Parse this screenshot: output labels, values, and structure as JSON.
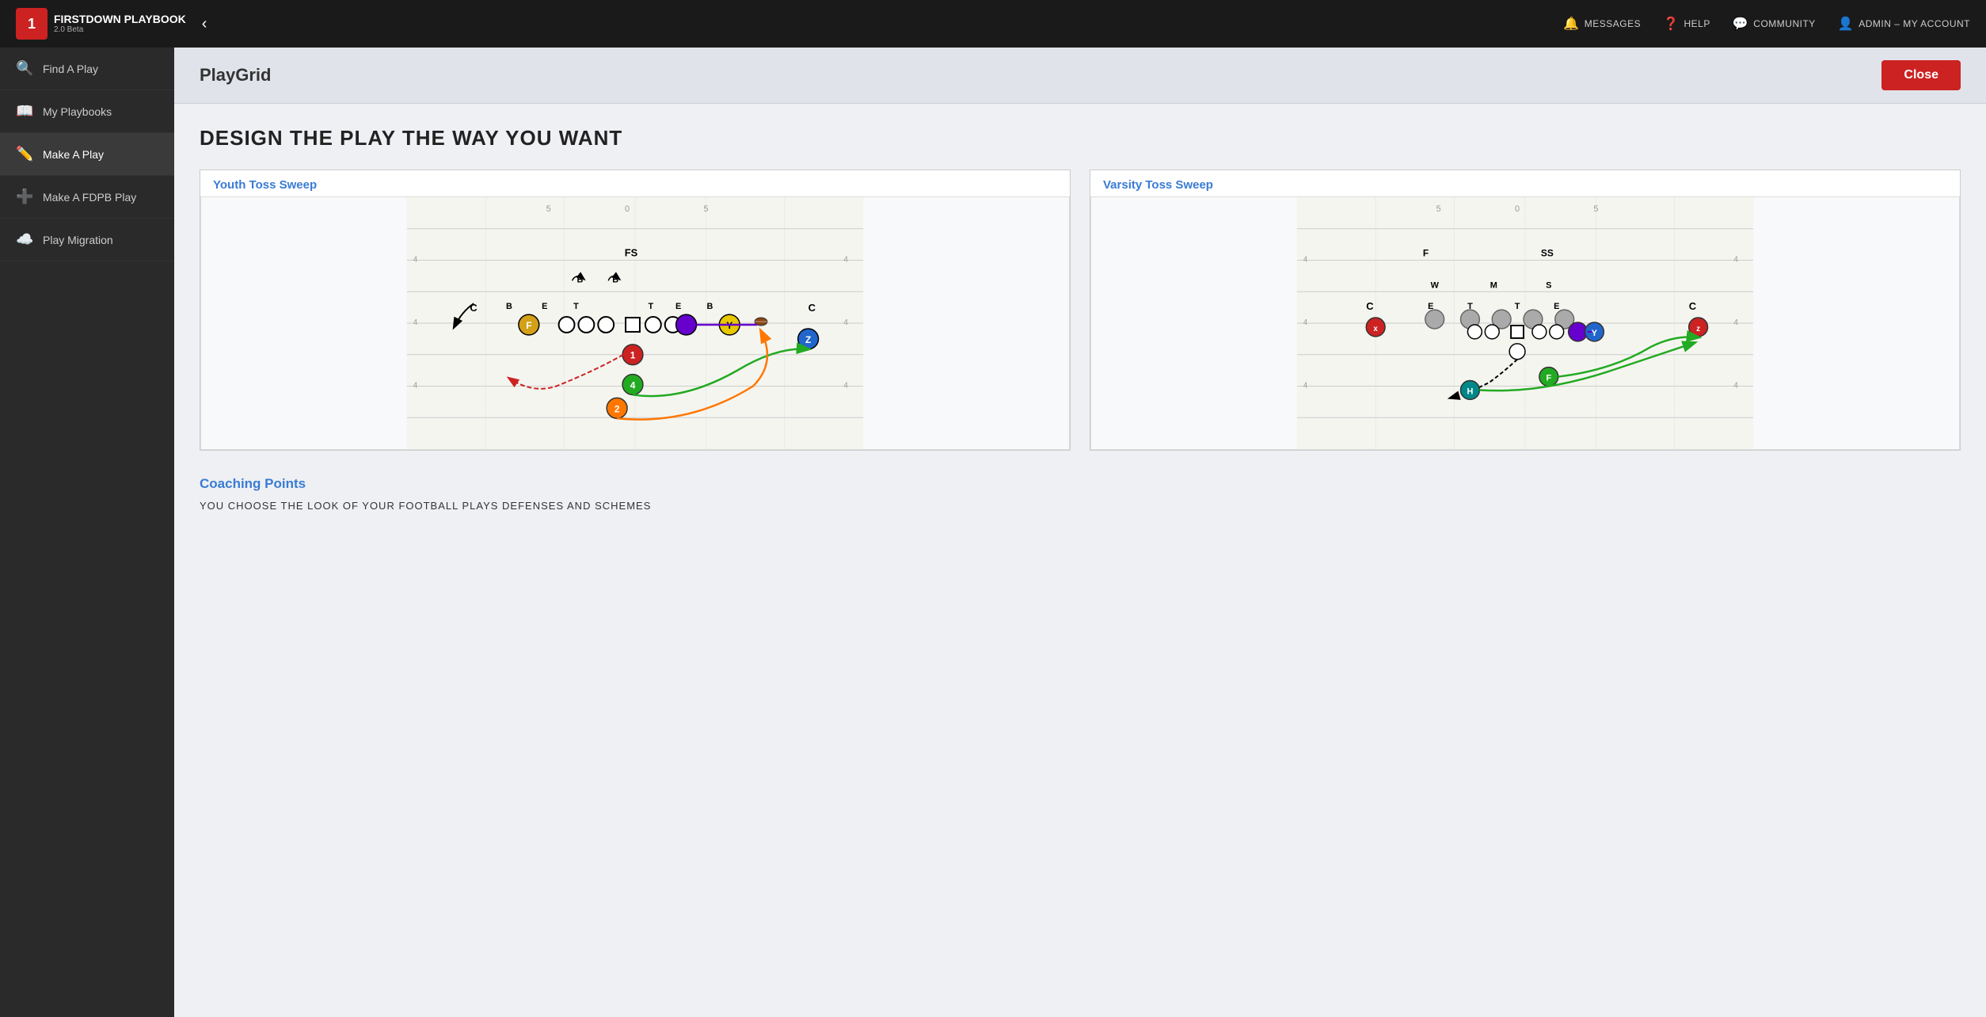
{
  "app": {
    "name": "FIRSTDOWN PLAYBOOK",
    "version": "2.0 Beta",
    "logo_number": "1"
  },
  "top_nav": {
    "toggle_icon": "‹",
    "links": [
      {
        "id": "messages",
        "label": "MESSAGES",
        "icon": "🔔"
      },
      {
        "id": "help",
        "label": "HELP",
        "icon": "?"
      },
      {
        "id": "community",
        "label": "COMMUNITY",
        "icon": "💬"
      },
      {
        "id": "admin",
        "label": "ADMIN – MY ACCOUNT",
        "icon": "👤"
      }
    ]
  },
  "sidebar": {
    "items": [
      {
        "id": "find-play",
        "label": "Find A Play",
        "icon": "🔍"
      },
      {
        "id": "my-playbooks",
        "label": "My Playbooks",
        "icon": "📖"
      },
      {
        "id": "make-play",
        "label": "Make A Play",
        "icon": "✏️"
      },
      {
        "id": "make-fdpb-play",
        "label": "Make A FDPB Play",
        "icon": "➕"
      },
      {
        "id": "play-migration",
        "label": "Play Migration",
        "icon": "☁️"
      }
    ]
  },
  "page": {
    "title": "PlayGrid",
    "close_button": "Close",
    "headline": "DESIGN THE PLAY THE WAY YOU WANT"
  },
  "plays": [
    {
      "id": "youth-toss-sweep",
      "title": "Youth Toss Sweep"
    },
    {
      "id": "varsity-toss-sweep",
      "title": "Varsity Toss Sweep"
    }
  ],
  "coaching": {
    "title": "Coaching Points",
    "text": "YOU CHOOSE THE LOOK OF YOUR FOOTBALL PLAYS DEFENSES AND SCHEMES"
  }
}
